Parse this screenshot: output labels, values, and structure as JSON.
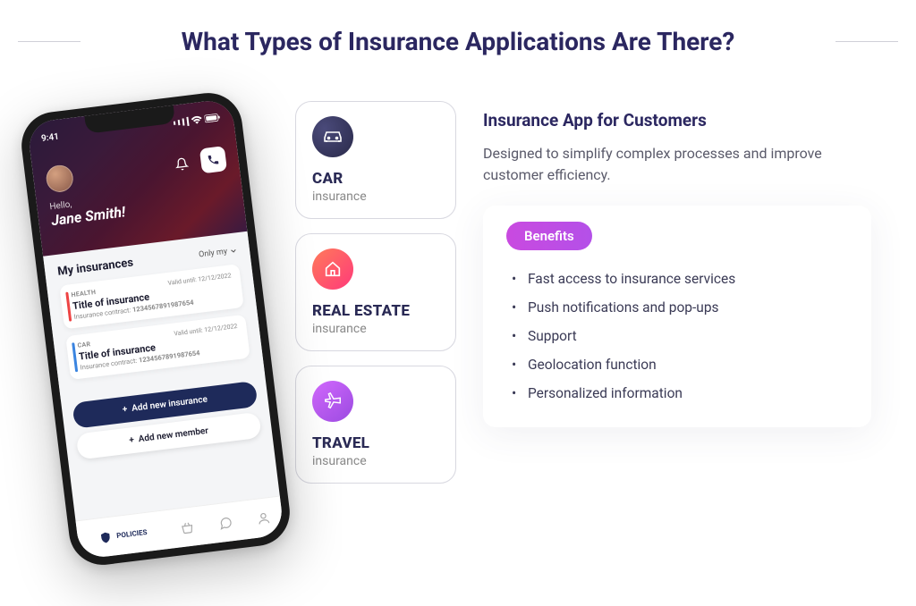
{
  "page_title": "What Types of Insurance Applications Are There?",
  "phone": {
    "status_time": "9:41",
    "greeting_small": "Hello,",
    "greeting_name": "Jane Smith!",
    "section_title": "My insurances",
    "filter_label": "Only my",
    "cards": [
      {
        "tag": "HEALTH",
        "valid": "Valid until: 12/12/2022",
        "title": "Title of insurance",
        "contract_label": "Insurance contract:",
        "contract": "1234567891987654"
      },
      {
        "tag": "CAR",
        "valid": "Valid until: 12/12/2022",
        "title": "Title of insurance",
        "contract_label": "Insurance contract:",
        "contract": "1234567891987654"
      }
    ],
    "btn_add_insurance": "Add new insurance",
    "btn_add_member": "Add new member",
    "tab_policies": "POLICIES"
  },
  "categories": [
    {
      "title": "CAR",
      "sub": "insurance"
    },
    {
      "title": "REAL ESTATE",
      "sub": "insurance"
    },
    {
      "title": "TRAVEL",
      "sub": "insurance"
    }
  ],
  "info": {
    "title": "Insurance App for Customers",
    "desc": "Designed to simplify complex processes and improve customer efficiency.",
    "benefits_label": "Benefits",
    "benefits": [
      "Fast access to insurance services",
      "Push notifications and pop-ups",
      "Support",
      "Geolocation function",
      "Personalized information"
    ]
  }
}
